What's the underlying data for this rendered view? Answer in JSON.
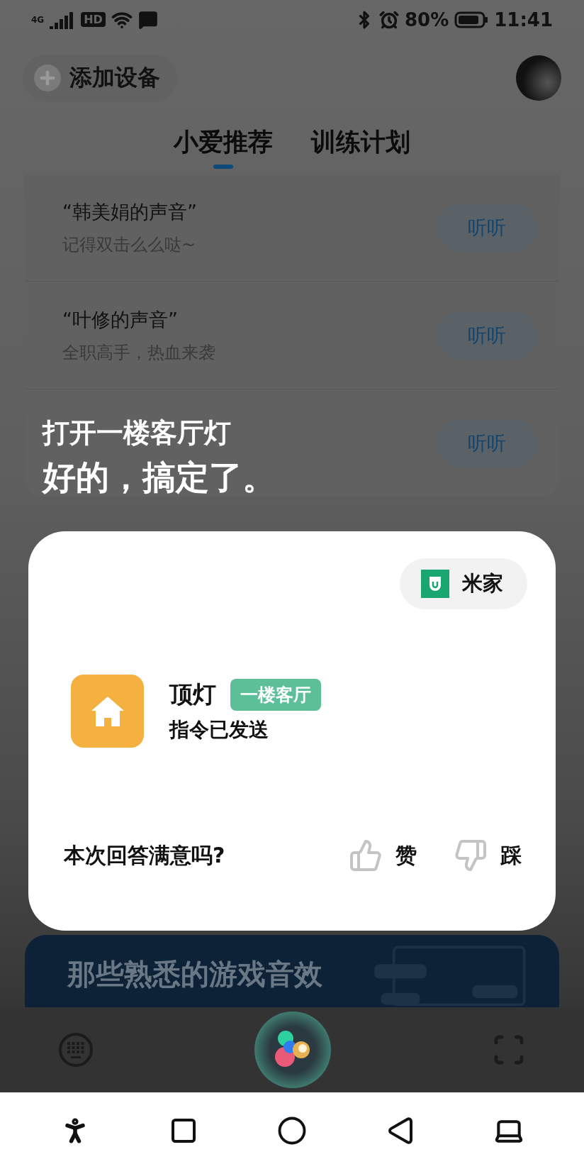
{
  "status_bar": {
    "network": "4G",
    "hd": "HD",
    "battery": "80%",
    "time": "11:41"
  },
  "header": {
    "add_device": "添加设备"
  },
  "tabs": [
    {
      "label": "小爱推荐",
      "selected": true
    },
    {
      "label": "训练计划",
      "selected": false
    }
  ],
  "voices": [
    {
      "title": "“韩美娟的声音”",
      "subtitle": "记得双击么么哒~",
      "button": "听听"
    },
    {
      "title": "“叶修的声音”",
      "subtitle": "全职高手，热血来袭",
      "button": "听听"
    },
    {
      "button": "听听"
    }
  ],
  "banner": {
    "title": "那些熟悉的游戏音效"
  },
  "assistant": {
    "query": "打开一楼客厅灯",
    "reply": "好的，搞定了。",
    "card": {
      "source": "米家",
      "device": "顶灯",
      "room": "一楼客厅",
      "status": "指令已发送",
      "feedback": {
        "question": "本次回答满意吗?",
        "like": "赞",
        "dislike": "踩"
      }
    }
  }
}
